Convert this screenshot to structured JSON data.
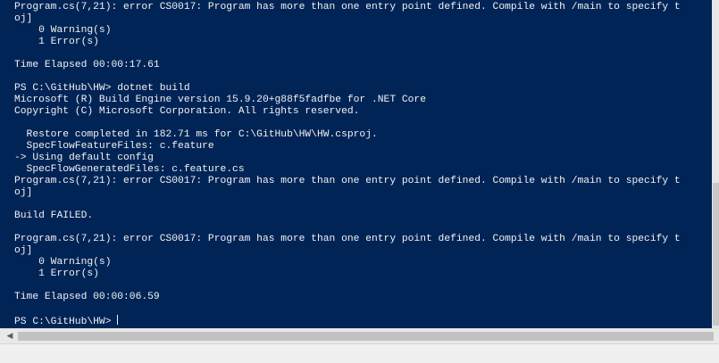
{
  "console": {
    "background": "#012456",
    "foreground": "#f2f2f2",
    "lines": [
      "Program.cs(7,21): error CS0017: Program has more than one entry point defined. Compile with /main to specify t",
      "oj]",
      "    0 Warning(s)",
      "    1 Error(s)",
      "",
      "Time Elapsed 00:00:17.61",
      "",
      "PS C:\\GitHub\\HW> dotnet build",
      "Microsoft (R) Build Engine version 15.9.20+g88f5fadfbe for .NET Core",
      "Copyright (C) Microsoft Corporation. All rights reserved.",
      "",
      "  Restore completed in 182.71 ms for C:\\GitHub\\HW\\HW.csproj.",
      "  SpecFlowFeatureFiles: c.feature",
      "-> Using default config",
      "  SpecFlowGeneratedFiles: c.feature.cs",
      "Program.cs(7,21): error CS0017: Program has more than one entry point defined. Compile with /main to specify t",
      "oj]",
      "",
      "Build FAILED.",
      "",
      "Program.cs(7,21): error CS0017: Program has more than one entry point defined. Compile with /main to specify t",
      "oj]",
      "    0 Warning(s)",
      "    1 Error(s)",
      "",
      "Time Elapsed 00:00:06.59",
      ""
    ],
    "prompt": "PS C:\\GitHub\\HW> "
  },
  "scrollbars": {
    "left_arrow_icon": "triangle-left"
  }
}
